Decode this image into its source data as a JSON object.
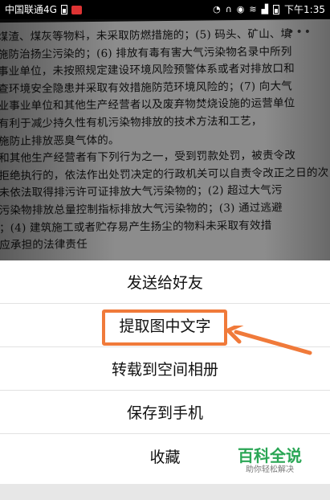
{
  "status_bar": {
    "carrier": "中国联通4G",
    "time": "下午1:35",
    "icons": [
      "battery-icon",
      "weibo-icon",
      "alarm-icon",
      "headset-icon",
      "eye-icon",
      "wifi-icon",
      "signal-icon",
      "battery-icon"
    ]
  },
  "photo": {
    "lines": [
      "煤渣、煤灰等物料，未采取防燃措施的；(5) 码头、矿山、填",
      "施防治扬尘污染的；(6) 排放有毒有害大气污染物名录中所列",
      "事业单位，未按照规定建设环境风险预警体系或者对排放口和",
      "查环境安全隐患并采取有效措施防范环境风险的；(7) 向大气",
      "业事业单位和其他生产经营者以及废弃物焚烧设施的运营单位",
      "有利于减少持久性有机污染物排放的技术方法和工艺，",
      "施防止排放恶臭气体的。",
      "和其他生产经营者有下列行为之一，受到罚款处罚，被责令改",
      "拒绝执行的，依法作出处罚决定的行政机关可以自责令改正之日的次日起，按照原",
      "未依法取得排污许可证排放大气污染物的；(2) 超过大气污",
      "污染物排放总量控制指标排放大气污染物的；(3) 通过逃避",
      "；(4) 建筑施工或者贮存易产生扬尘的物料未采取有效措",
      "应承担的法律责任"
    ]
  },
  "menu": {
    "items": [
      {
        "label": "发送给好友"
      },
      {
        "label": "提取图中文字"
      },
      {
        "label": "转载到空间相册"
      },
      {
        "label": "保存到手机"
      },
      {
        "label": "收藏"
      }
    ]
  },
  "annotation": {
    "color": "#f07a3a"
  },
  "watermark": {
    "title": "百科全说",
    "subtitle": "助你轻松解决"
  }
}
